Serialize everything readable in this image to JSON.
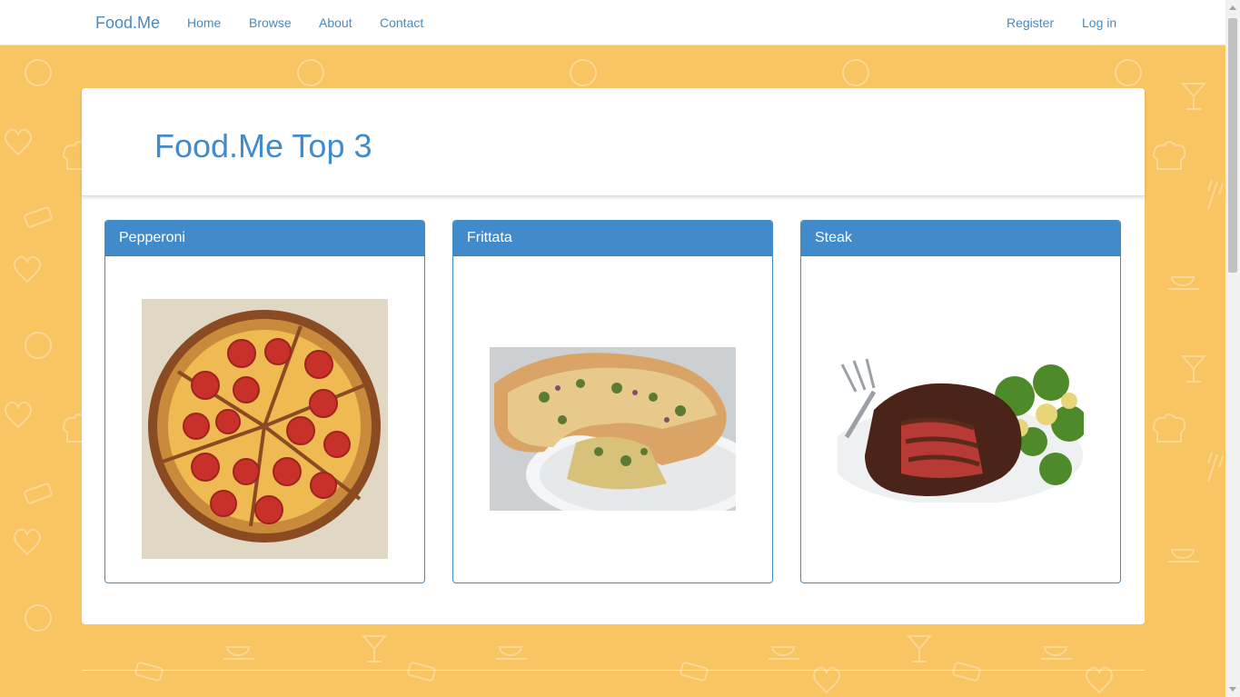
{
  "navbar": {
    "brand": "Food.Me",
    "links": [
      "Home",
      "Browse",
      "About",
      "Contact"
    ],
    "register": "Register",
    "login": "Log in"
  },
  "main": {
    "title": "Food.Me Top 3",
    "cards": [
      {
        "title": "Pepperoni",
        "image": "pepperoni-pizza-photo"
      },
      {
        "title": "Frittata",
        "image": "frittata-photo"
      },
      {
        "title": "Steak",
        "image": "steak-photo"
      }
    ]
  },
  "colors": {
    "background": "#f9c462",
    "accent": "#428bca"
  }
}
